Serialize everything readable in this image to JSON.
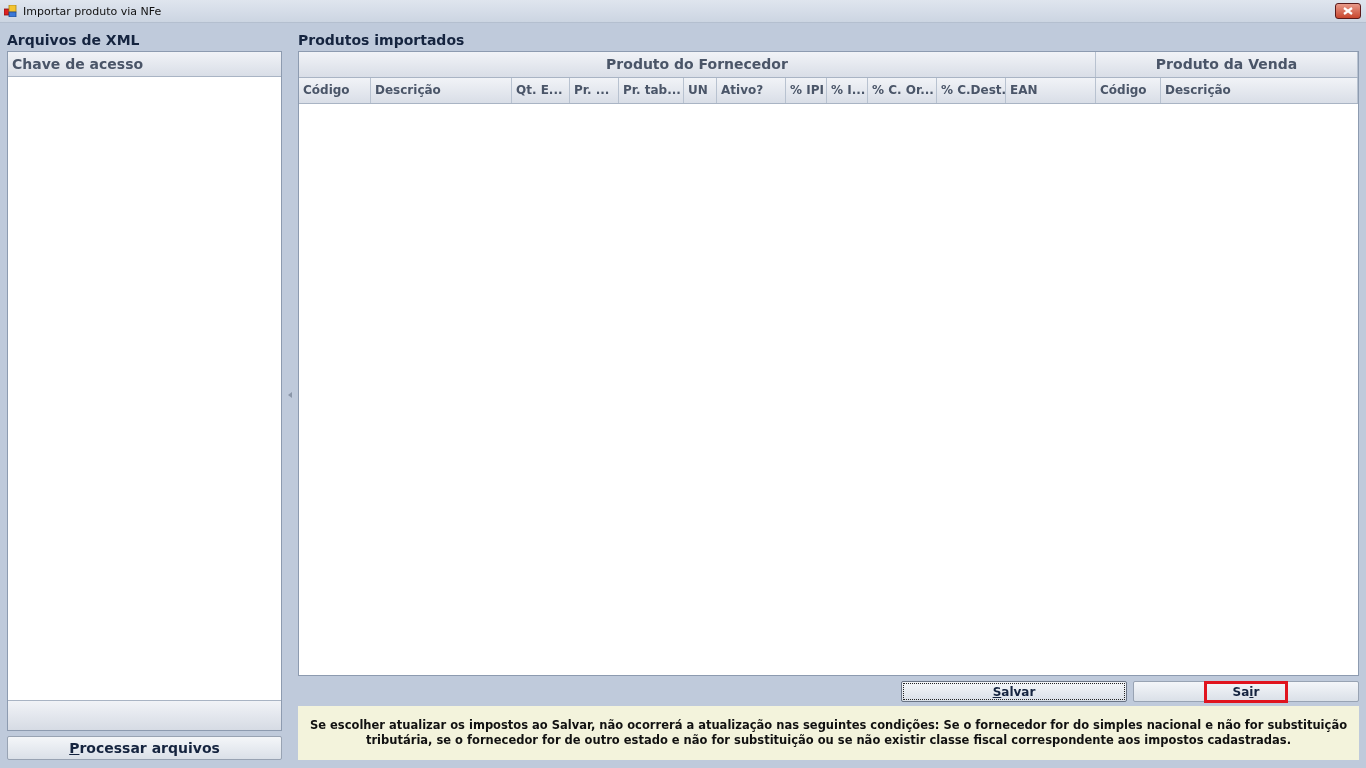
{
  "window": {
    "title": "Importar produto via NFe"
  },
  "left_panel": {
    "title": "Arquivos de XML",
    "list": {
      "columns": [
        "Chave de acesso"
      ]
    },
    "button": {
      "mnemonic": "P",
      "after": "rocessar arquivos"
    }
  },
  "right_panel": {
    "title": "Produtos importados",
    "table": {
      "column_groups": [
        {
          "title": "Produto do Fornecedor",
          "columns": [
            "Código",
            "Descrição",
            "Qt. E...",
            "Pr. ...",
            "Pr. tab...",
            "UN",
            "Ativo?",
            "% IPI",
            "% I...",
            "% C. Or...",
            "% C.Dest.",
            "EAN"
          ]
        },
        {
          "title": "Produto da Venda",
          "columns": [
            "Código",
            "Descrição"
          ]
        }
      ]
    },
    "buttons": [
      {
        "mnemonic": "S",
        "after": "alvar",
        "focused": true,
        "highlighted": false
      },
      {
        "before": "Sa",
        "mnemonic": "i",
        "after": "r",
        "focused": false,
        "highlighted": true
      }
    ],
    "note": "Se escolher atualizar os impostos ao Salvar, não ocorrerá a atualização nas seguintes condições: Se o fornecedor for do simples nacional e não for substituição tributária, se o fornecedor for de outro estado e não for substituição ou se não existir classe fiscal correspondente aos impostos cadastradas."
  }
}
